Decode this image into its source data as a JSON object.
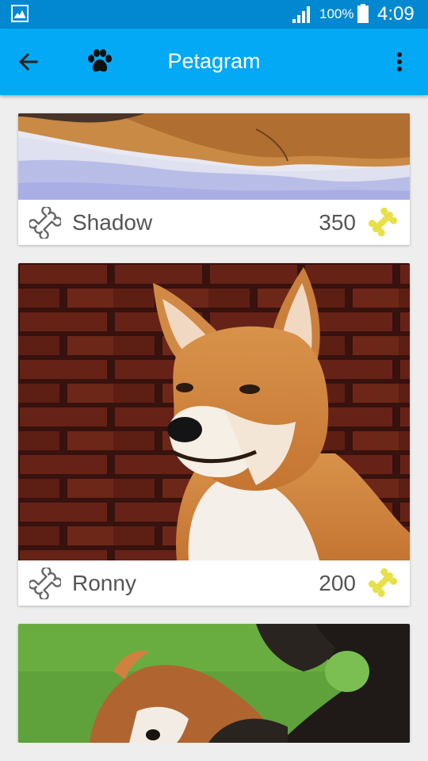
{
  "status_bar": {
    "battery_percent": "100%",
    "time": "4:09",
    "icons": [
      "gallery-icon",
      "signal-icon",
      "battery-icon"
    ]
  },
  "app_bar": {
    "title": "Petagram",
    "icons": [
      "back-arrow-icon",
      "paw-icon",
      "overflow-menu-icon"
    ]
  },
  "theme": {
    "primary": "#03a9f4",
    "primary_dark": "#0288d1",
    "accent_bone": "#e8e04a",
    "text_secondary": "#555555"
  },
  "pets": [
    {
      "name": "Shadow",
      "likes": "350"
    },
    {
      "name": "Ronny",
      "likes": "200"
    },
    {
      "name": "",
      "likes": ""
    }
  ]
}
